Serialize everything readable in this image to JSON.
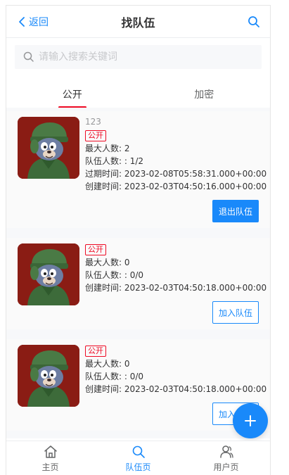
{
  "nav": {
    "back_label": "返回",
    "title": "找队伍"
  },
  "search": {
    "placeholder": "请输入搜索关键词",
    "value": ""
  },
  "tabs": [
    {
      "label": "公开",
      "active": true
    },
    {
      "label": "加密",
      "active": false
    }
  ],
  "teams": [
    {
      "description": "123",
      "status_tag": "公开",
      "max_members": "最大人数: 2",
      "member_count": "队伍人数: : 1/2",
      "expire_time": "过期时间: 2023-02-08T05:58:31.000+00:00",
      "create_time": "创建时间: 2023-02-03T04:50:16.000+00:00",
      "action_label": "退出队伍"
    },
    {
      "status_tag": "公开",
      "max_members": "最大人数: 0",
      "member_count": "队伍人数: : 0/0",
      "create_time": "创建时间: 2023-02-03T04:50:18.000+00:00",
      "action_label": "加入队伍"
    },
    {
      "status_tag": "公开",
      "max_members": "最大人数: 0",
      "member_count": "队伍人数: : 0/0",
      "create_time": "创建时间: 2023-02-03T04:50:18.000+00:00",
      "action_label": "加入队伍"
    }
  ],
  "fab": {
    "icon": "plus-icon"
  },
  "tabbar": [
    {
      "label": "主页",
      "icon": "home-icon",
      "active": false
    },
    {
      "label": "队伍页",
      "icon": "search-icon",
      "active": true
    },
    {
      "label": "用户页",
      "icon": "user-icon",
      "active": false
    }
  ],
  "colors": {
    "primary": "#1989fa",
    "danger": "#ee0a24",
    "thumb_bg": "#8a1c14"
  }
}
